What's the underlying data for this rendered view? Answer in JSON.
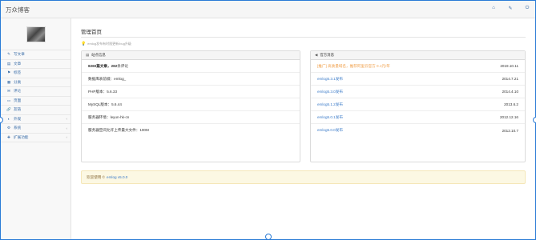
{
  "app": {
    "brand": "万众博客"
  },
  "topbar": {
    "icons": [
      {
        "name": "home-icon",
        "glyph": "⌂"
      },
      {
        "name": "wrench-icon",
        "glyph": "✎"
      },
      {
        "name": "power-icon",
        "glyph": "⏻"
      }
    ]
  },
  "sidebar": {
    "items": [
      {
        "icon": "✎",
        "label": "写文章",
        "arrow": ""
      },
      {
        "icon": "▤",
        "label": "文章",
        "arrow": ""
      },
      {
        "icon": "⚑",
        "label": "标签",
        "arrow": ""
      },
      {
        "icon": "▦",
        "label": "分类",
        "arrow": ""
      },
      {
        "icon": "✉",
        "label": "评论",
        "arrow": ""
      },
      {
        "icon": "▭",
        "label": "页面",
        "arrow": ""
      },
      {
        "icon": "🔗",
        "label": "友链",
        "arrow": ""
      },
      {
        "icon": "◐",
        "label": "外观",
        "arrow": "‹"
      },
      {
        "icon": "⚙",
        "label": "系统",
        "arrow": "‹"
      },
      {
        "icon": "✚",
        "label": "扩展功能",
        "arrow": "‹"
      }
    ]
  },
  "main": {
    "title": "管理首页",
    "notice": "emlog发布有时限更新/bug升级",
    "site_info": {
      "heading": "站点信息",
      "stats_line": {
        "posts": "8",
        "posts_unit": "260篇文章，",
        "comments": "282",
        "comments_unit": "条评论"
      },
      "rows": [
        "数据库表前缀：emlog_",
        "PHP版本：5.6.33",
        "MySQL版本：5.6.44",
        "服务器环境：leyun-hk-cn",
        "服务器空间允许上传最大文件：100M"
      ]
    },
    "official_news": {
      "heading": "官方消息",
      "rows": [
        {
          "text": "[推广] 高质量域名，推荐阿里云官方 0.1元/年",
          "date": "2019.10.11",
          "style": "orange"
        },
        {
          "text": "emlog5.3.1发布",
          "date": "2014.7.21",
          "style": "blue"
        },
        {
          "text": "emlog5.3.0发布",
          "date": "2014.4.10",
          "style": "blue"
        },
        {
          "text": "emlog5.1.2发布",
          "date": "2013.6.2",
          "style": "blue"
        },
        {
          "text": "emlog5.0.1发布",
          "date": "2012.12.16",
          "style": "blue"
        },
        {
          "text": "emlog5.0.0发布",
          "date": "2012.10.7",
          "style": "blue"
        }
      ]
    },
    "welcome": {
      "prefix": "欢迎使用 ©",
      "link": "emlog v5.0.0"
    }
  },
  "colors": {
    "accent": "#3a7ac8",
    "frame": "#2a7bd6",
    "welcome_bg": "#fcf8e3",
    "highlight": "#f0a04b"
  }
}
